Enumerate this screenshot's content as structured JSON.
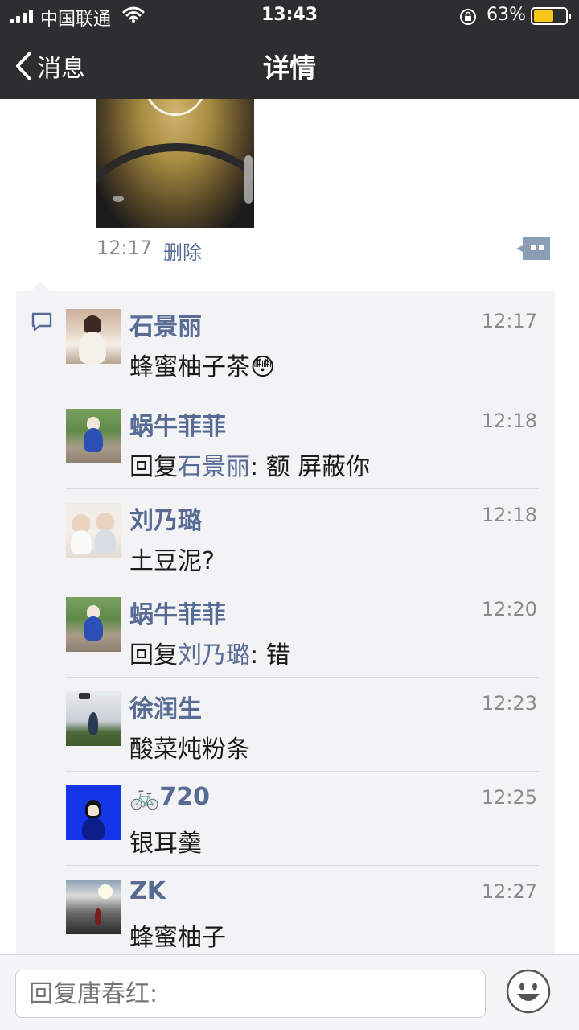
{
  "status_bar": {
    "carrier": "中国联通",
    "time": "13:43",
    "battery_percent": "63%",
    "battery_level": 0.63
  },
  "nav": {
    "back_label": "消息",
    "title": "详情"
  },
  "post": {
    "time": "12:17",
    "delete_label": "删除"
  },
  "comments": [
    {
      "name": "石景丽",
      "time": "12:17",
      "text": "蜂蜜柚子茶",
      "emoji": "😳"
    },
    {
      "name": "蜗牛菲菲",
      "time": "12:18",
      "reply_prefix": "回复",
      "reply_to": "石景丽",
      "text": ": 额 屏蔽你"
    },
    {
      "name": "刘乃璐",
      "time": "12:18",
      "text": "土豆泥?"
    },
    {
      "name": "蜗牛菲菲",
      "time": "12:20",
      "reply_prefix": "回复",
      "reply_to": "刘乃璐",
      "text": ": 错"
    },
    {
      "name": "徐润生",
      "time": "12:23",
      "text": "酸菜炖粉条"
    },
    {
      "name_icon": "🚲",
      "name": "720",
      "time": "12:25",
      "text": "银耳羹"
    },
    {
      "name": "ZK",
      "time": "12:27",
      "text": "蜂蜜柚子"
    }
  ],
  "reply_bar": {
    "placeholder": "回复唐春红:"
  },
  "colors": {
    "header_bg": "#2e2e30",
    "link_blue": "#576b95",
    "panel_bg": "#f3f3f5",
    "battery_fill": "#f8c81c"
  }
}
